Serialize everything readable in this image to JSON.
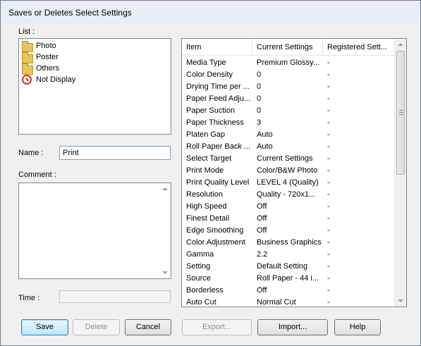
{
  "window": {
    "title": "Saves or Deletes Select Settings"
  },
  "list": {
    "label": "List :",
    "items": [
      {
        "label": "Photo",
        "icon": "folder-icon"
      },
      {
        "label": "Poster",
        "icon": "folder-icon"
      },
      {
        "label": "Others",
        "icon": "folder-icon"
      },
      {
        "label": "Not Display",
        "icon": "no-entry-icon"
      }
    ]
  },
  "name": {
    "label": "Name :",
    "value": "Print"
  },
  "comment": {
    "label": "Comment :",
    "value": ""
  },
  "time": {
    "label": "Time :",
    "value": ""
  },
  "settings_table": {
    "headers": [
      "Item",
      "Current Settings",
      "Registered Sett..."
    ],
    "rows": [
      [
        "Media Type",
        "Premium Glossy...",
        "-"
      ],
      [
        "Color Density",
        "0",
        "-"
      ],
      [
        "Drying Time per ...",
        "0",
        "-"
      ],
      [
        "Paper Feed Adju...",
        "0",
        "-"
      ],
      [
        "Paper Suction",
        "0",
        "-"
      ],
      [
        "Paper Thickness",
        "3",
        "-"
      ],
      [
        "Platen Gap",
        "Auto",
        "-"
      ],
      [
        "Roll Paper Back ...",
        "Auto",
        "-"
      ],
      [
        "Select Target",
        "Current Settings",
        "-"
      ],
      [
        "Print Mode",
        "Color/B&W Photo",
        "-"
      ],
      [
        "Print Quality Level",
        "LEVEL 4 (Quality)",
        "-"
      ],
      [
        "Resolution",
        "Quality - 720x1...",
        "-"
      ],
      [
        "High Speed",
        "Off",
        "-"
      ],
      [
        "Finest Detail",
        "Off",
        "-"
      ],
      [
        "Edge Smoothing",
        "Off",
        "-"
      ],
      [
        "Color Adjustment",
        "Business Graphics",
        "-"
      ],
      [
        "Gamma",
        "2.2",
        "-"
      ],
      [
        "Setting",
        "Default Setting",
        "-"
      ],
      [
        "Source",
        "Roll Paper - 44 i...",
        "-"
      ],
      [
        "Borderless",
        "Off",
        "-"
      ],
      [
        "Auto Cut",
        "Normal Cut",
        "-"
      ]
    ]
  },
  "buttons": {
    "save": "Save",
    "delete": "Delete",
    "cancel": "Cancel",
    "export": "Export...",
    "import": "Import...",
    "help": "Help"
  }
}
